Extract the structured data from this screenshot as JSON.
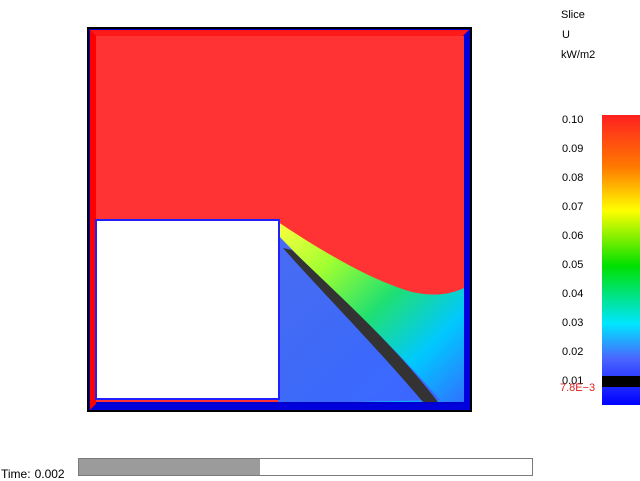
{
  "legend": {
    "title": "Slice",
    "variable": "U",
    "unit": "kW/m2",
    "ticks": [
      "0.10",
      "0.09",
      "0.08",
      "0.07",
      "0.06",
      "0.05",
      "0.04",
      "0.03",
      "0.02",
      "0.01"
    ],
    "marker_value": "7.8E−3",
    "marker_color": "#e02020",
    "colorbar_colors": [
      "#ff2020",
      "#ff8a00",
      "#ffff00",
      "#00e800",
      "#00e0ff",
      "#2a5cff",
      "#0000ff"
    ]
  },
  "time": {
    "label": "Time:",
    "value": "0.002",
    "progress": 0.4
  },
  "colors": {
    "hot": "#ff3333",
    "cold": "#3f63ff",
    "border_blue": "#0000cc",
    "border_red": "#ff0000",
    "band_dark": "#333333"
  }
}
